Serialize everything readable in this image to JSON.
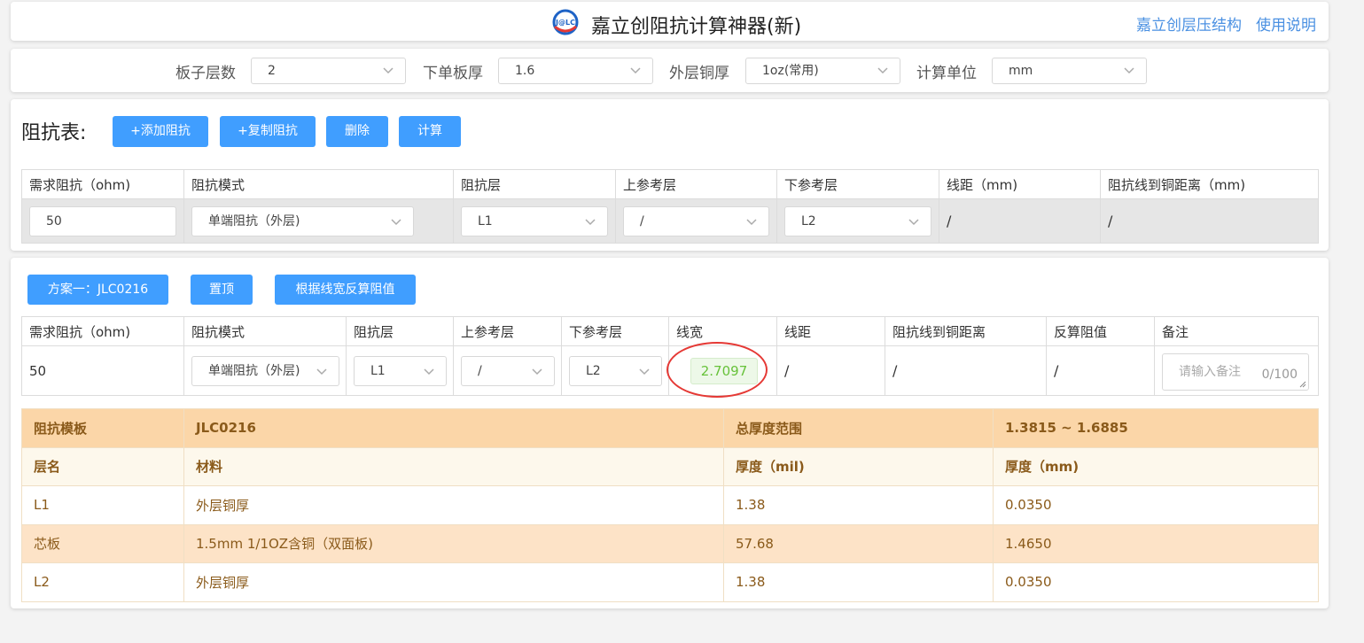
{
  "header": {
    "logo_text": "J@LC",
    "title": "嘉立创阻抗计算神器(新)",
    "link_stackup": "嘉立创层压结构",
    "link_help": "使用说明"
  },
  "settings": {
    "layers_label": "板子层数",
    "layers_value": "2",
    "thickness_label": "下单板厚",
    "thickness_value": "1.6",
    "copper_label": "外层铜厚",
    "copper_value": "1oz(常用)",
    "unit_label": "计算单位",
    "unit_value": "mm"
  },
  "impedance_table": {
    "title": "阻抗表:",
    "buttons": {
      "add": "+添加阻抗",
      "copy": "+复制阻抗",
      "delete": "删除",
      "calc": "计算"
    },
    "headers": [
      "需求阻抗（ohm)",
      "阻抗模式",
      "阻抗层",
      "上参考层",
      "下参考层",
      "线距（mm)",
      "阻抗线到铜距离（mm)"
    ],
    "row": {
      "impedance": "50",
      "mode": "单端阻抗（外层)",
      "layer": "L1",
      "upper_ref": "/",
      "lower_ref": "L2",
      "spacing": "/",
      "to_copper": "/"
    }
  },
  "solution": {
    "scheme_button": "方案一：JLC0216",
    "pin_button": "置顶",
    "reverse_button": "根据线宽反算阻值",
    "headers": [
      "需求阻抗（ohm)",
      "阻抗模式",
      "阻抗层",
      "上参考层",
      "下参考层",
      "线宽",
      "线距",
      "阻抗线到铜距离",
      "反算阻值",
      "备注"
    ],
    "row": {
      "impedance": "50",
      "mode": "单端阻抗（外层)",
      "layer": "L1",
      "upper_ref": "/",
      "lower_ref": "L2",
      "line_width": "2.7097",
      "spacing": "/",
      "to_copper": "/",
      "reverse_value": "/",
      "remark_placeholder": "请输入备注",
      "remark_count": "0/100"
    }
  },
  "stackup": {
    "template_label": "阻抗模板",
    "template_value": "JLC0216",
    "range_label": "总厚度范围",
    "range_value": "1.3815 ~ 1.6885",
    "headers": [
      "层名",
      "材料",
      "厚度（mil)",
      "厚度（mm)"
    ],
    "rows": [
      {
        "name": "L1",
        "material": "外层铜厚",
        "mil": "1.38",
        "mm": "0.0350"
      },
      {
        "name": "芯板",
        "material": "1.5mm 1/1OZ含铜（双面板)",
        "mil": "57.68",
        "mm": "1.4650"
      },
      {
        "name": "L2",
        "material": "外层铜厚",
        "mil": "1.38",
        "mm": "0.0350"
      }
    ]
  },
  "colors": {
    "primary": "#409eff",
    "highlight_circle": "#e53935",
    "width_value": "#67c23a",
    "stack_header": "#fbd6a8",
    "stack_text": "#8a5a1a"
  }
}
